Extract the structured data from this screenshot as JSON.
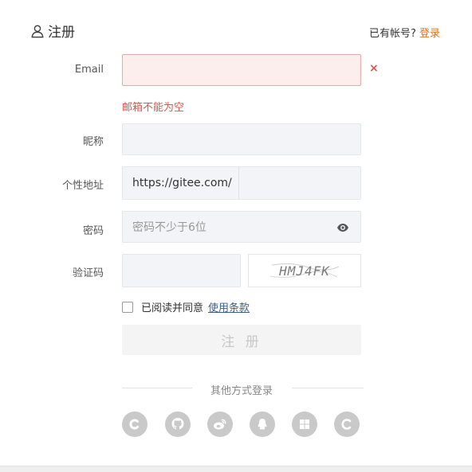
{
  "header": {
    "title": "注册",
    "login_prompt": "已有帐号?",
    "login_link": "登录"
  },
  "form": {
    "email": {
      "label": "Email",
      "value": "",
      "error_mark": "×",
      "error": "邮箱不能为空"
    },
    "nickname": {
      "label": "昵称",
      "value": ""
    },
    "address": {
      "label": "个性地址",
      "prefix": "https://gitee.com/",
      "value": ""
    },
    "password": {
      "label": "密码",
      "placeholder": "密码不少于6位"
    },
    "captcha": {
      "label": "验证码",
      "value": "",
      "image_text": "HMJ4FK"
    },
    "agree": {
      "text": "已阅读并同意",
      "terms_link": "使用条款"
    },
    "submit_label": "注 册"
  },
  "other_login": {
    "title": "其他方式登录",
    "providers": [
      "c-icon",
      "github-icon",
      "weibo-icon",
      "qq-icon",
      "windows-icon",
      "c-outline-icon"
    ]
  },
  "colors": {
    "accent": "#e57419",
    "error": "#d9534f",
    "link": "#3a5f8a"
  }
}
